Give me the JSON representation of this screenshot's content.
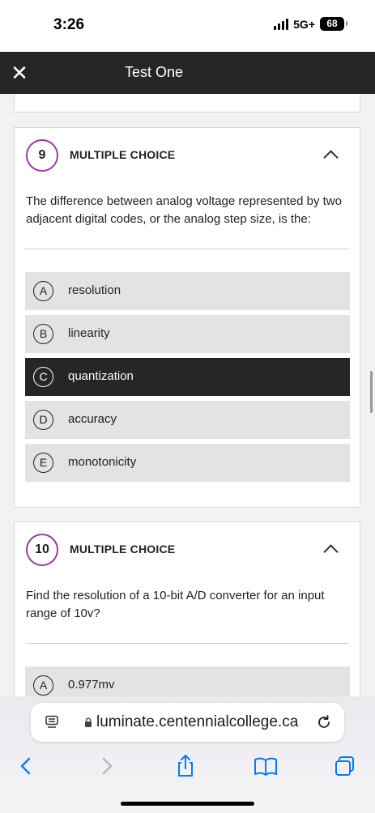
{
  "status_bar": {
    "time": "3:26",
    "network": "5G+",
    "battery": "68"
  },
  "header": {
    "title": "Test One",
    "close_icon": "close-icon"
  },
  "questions": [
    {
      "number": "9",
      "type": "MULTIPLE CHOICE",
      "text": "The difference between analog voltage represented by two adjacent digital codes, or the analog step size, is the:",
      "options": [
        {
          "letter": "A",
          "label": "resolution",
          "selected": false
        },
        {
          "letter": "B",
          "label": "linearity",
          "selected": false
        },
        {
          "letter": "C",
          "label": "quantization",
          "selected": true
        },
        {
          "letter": "D",
          "label": "accuracy",
          "selected": false
        },
        {
          "letter": "E",
          "label": "monotonicity",
          "selected": false
        }
      ]
    },
    {
      "number": "10",
      "type": "MULTIPLE CHOICE",
      "text": "Find the resolution of a 10-bit A/D converter for an input range of 10v?",
      "options": [
        {
          "letter": "A",
          "label": "0.977mv",
          "selected": false
        }
      ]
    }
  ],
  "browser": {
    "url": "luminate.centennialcollege.ca",
    "icons": [
      "reader-icon",
      "lock-icon",
      "reload-icon",
      "back-icon",
      "forward-icon",
      "share-icon",
      "bookmarks-icon",
      "tabs-icon"
    ]
  },
  "colors": {
    "accent_ring": "#9b3aa6",
    "header_bg": "#262626",
    "selected_option_bg": "#262626",
    "option_bg": "#e3e3e3",
    "ios_blue": "#007aff"
  }
}
